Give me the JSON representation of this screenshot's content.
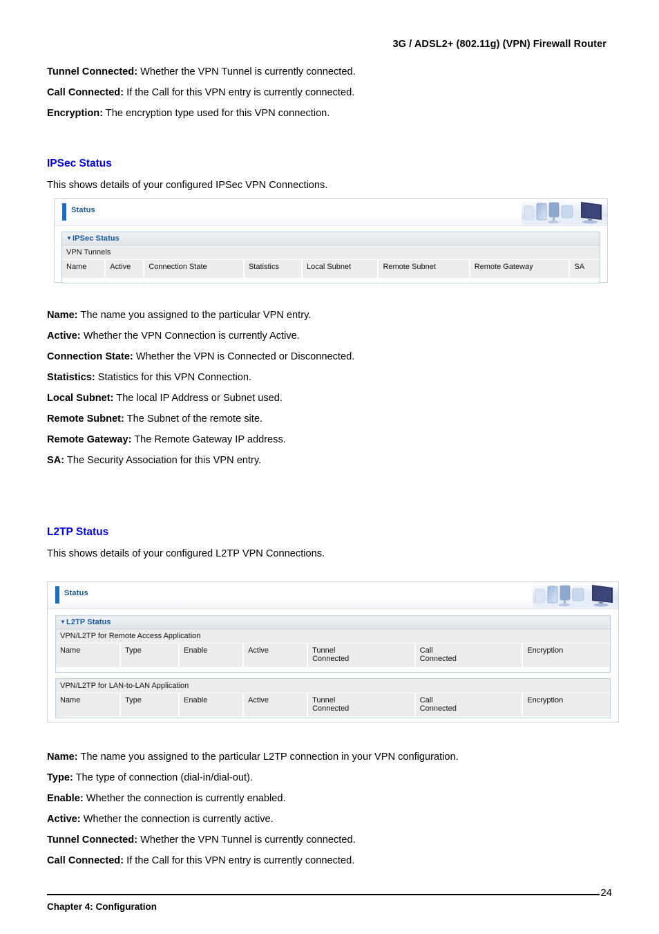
{
  "header": {
    "running_head": "3G / ADSL2+ (802.11g) (VPN) Firewall Router"
  },
  "top_definitions": [
    {
      "term": "Tunnel Connected:",
      "description": " Whether the VPN Tunnel is currently connected."
    },
    {
      "term": "Call Connected:",
      "description": " If the Call for this VPN entry is currently connected."
    },
    {
      "term": "Encryption:",
      "description": " The encryption type used for this VPN connection."
    }
  ],
  "ipsec_section": {
    "heading": "IPSec Status",
    "intro": "This shows details of your configured IPSec VPN Connections.",
    "widget": {
      "head_title": "Status",
      "deco_icon": "office-workstation-image",
      "panel_title": "IPSec Status",
      "caret": "▼",
      "subsection_title": "VPN Tunnels",
      "columns": [
        "Name",
        "Active",
        "Connection State",
        "Statistics",
        "Local Subnet",
        "Remote Subnet",
        "Remote Gateway",
        "SA"
      ]
    },
    "definitions": [
      {
        "term": "Name:",
        "description": " The name you assigned to the particular VPN entry."
      },
      {
        "term": "Active:",
        "description": " Whether the VPN Connection is currently Active."
      },
      {
        "term": "Connection State:",
        "description": " Whether the VPN is Connected or Disconnected."
      },
      {
        "term": "Statistics:",
        "description": " Statistics for this VPN Connection."
      },
      {
        "term": "Local Subnet:",
        "description": " The local IP Address or Subnet used."
      },
      {
        "term": "Remote Subnet:",
        "description": " The Subnet of the remote site."
      },
      {
        "term": "Remote Gateway:",
        "description": " The Remote Gateway IP address."
      },
      {
        "term": "SA:",
        "description": " The Security Association for this VPN entry."
      }
    ]
  },
  "l2tp_section": {
    "heading": "L2TP Status",
    "intro": "This shows details of your configured L2TP VPN Connections.",
    "widget": {
      "head_title": "Status",
      "deco_icon": "office-workstation-image",
      "panel_title": "L2TP Status",
      "caret": "▼",
      "remote_access": {
        "subsection_title": "VPN/L2TP for Remote Access Application",
        "columns": [
          "Name",
          "Type",
          "Enable",
          "Active",
          "Tunnel\nConnected",
          "Call\nConnected",
          "Encryption"
        ]
      },
      "lan_to_lan": {
        "subsection_title": "VPN/L2TP for LAN-to-LAN Application",
        "columns": [
          "Name",
          "Type",
          "Enable",
          "Active",
          "Tunnel\nConnected",
          "Call\nConnected",
          "Encryption"
        ]
      }
    },
    "definitions": [
      {
        "term": "Name:",
        "description": " The name you assigned to the particular L2TP connection in your VPN configuration."
      },
      {
        "term": "Type:",
        "description": " The type of connection (dial-in/dial-out)."
      },
      {
        "term": "Enable:",
        "description": " Whether the connection is currently enabled."
      },
      {
        "term": "Active:",
        "description": " Whether the connection is currently active."
      },
      {
        "term": "Tunnel Connected:",
        "description": " Whether the VPN Tunnel is currently connected."
      },
      {
        "term": "Call Connected:",
        "description": " If the Call for this VPN entry is currently connected."
      }
    ]
  },
  "footer": {
    "chapter": "Chapter 4: Configuration",
    "page_number": "24"
  },
  "colors": {
    "heading_blue": "#0000e0",
    "widget_title_blue": "#1457a0",
    "accent_bar_blue": "#1a6fc4",
    "table_header_gray": "#ececec",
    "panel_border_blue": "#b9cfe2"
  }
}
